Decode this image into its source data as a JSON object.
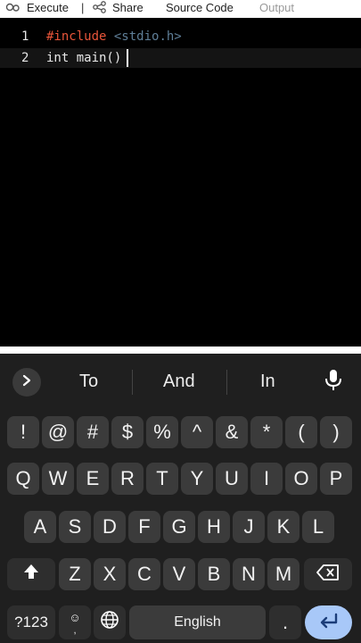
{
  "toolbar": {
    "execute_label": "Execute",
    "separator": "|",
    "share_label": "Share",
    "source_label": "Source Code",
    "output_label": "Output"
  },
  "editor": {
    "lines": [
      {
        "number": "1",
        "directive": "#include",
        "header": "<stdio.h>"
      },
      {
        "number": "2",
        "code": "int main()"
      }
    ]
  },
  "keyboard": {
    "suggestions": [
      "To",
      "And",
      "In"
    ],
    "row_symbols": [
      "!",
      "@",
      "#",
      "$",
      "%",
      "^",
      "&",
      "*",
      "(",
      ")"
    ],
    "row_q": [
      "Q",
      "W",
      "E",
      "R",
      "T",
      "Y",
      "U",
      "I",
      "O",
      "P"
    ],
    "row_a": [
      "A",
      "S",
      "D",
      "F",
      "G",
      "H",
      "J",
      "K",
      "L"
    ],
    "row_z": [
      "Z",
      "X",
      "C",
      "V",
      "B",
      "N",
      "M"
    ],
    "mode_label": "?123",
    "comma_label": ",",
    "emoji_symbol": "☺",
    "space_label": "English",
    "period_label": "."
  }
}
